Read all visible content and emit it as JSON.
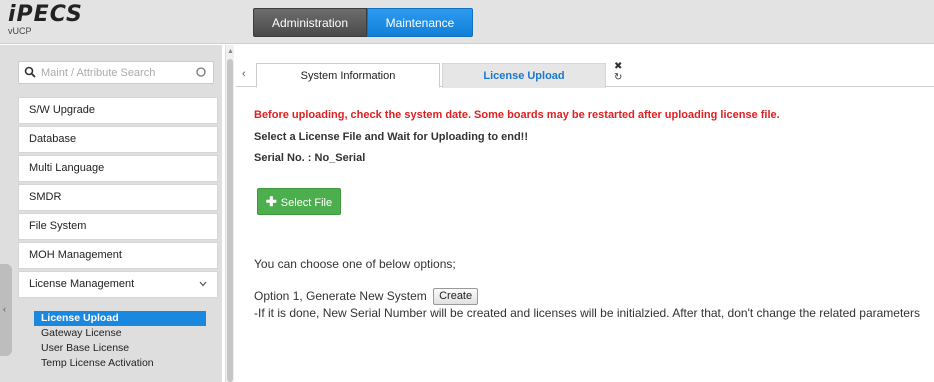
{
  "app": {
    "logo_text": "iPECS",
    "logo_sub": "vUCP"
  },
  "topnav": {
    "items": [
      {
        "label": "Administration"
      },
      {
        "label": "Maintenance"
      }
    ]
  },
  "search": {
    "placeholder": "Maint / Attribute Search"
  },
  "sidebar": {
    "items": [
      {
        "label": "S/W Upgrade"
      },
      {
        "label": "Database"
      },
      {
        "label": "Multi Language"
      },
      {
        "label": "SMDR"
      },
      {
        "label": "File System"
      },
      {
        "label": "MOH Management"
      },
      {
        "label": "License Management"
      }
    ],
    "subitems": [
      {
        "label": "License Upload"
      },
      {
        "label": "Gateway License"
      },
      {
        "label": "User Base License"
      },
      {
        "label": "Temp License Activation"
      }
    ]
  },
  "tabs": [
    {
      "label": "System Information"
    },
    {
      "label": "License Upload"
    }
  ],
  "main": {
    "warning": "Before uploading, check the system date. Some boards may be restarted after uploading license file.",
    "instruction": "Select a License File and Wait for Uploading to end!!",
    "serial": "Serial No. : No_Serial",
    "select_file_label": "Select File",
    "choose_text": "You can choose one of below options;",
    "option1_text": "Option 1, Generate New System",
    "create_label": "Create",
    "option1_note": "-If it is done, New Serial Number will be created and licenses will be initialzied. After that, don't change the related parameters"
  },
  "colors": {
    "accent": "#1b88e0",
    "warning": "#e02020",
    "success": "#4cae4c"
  }
}
